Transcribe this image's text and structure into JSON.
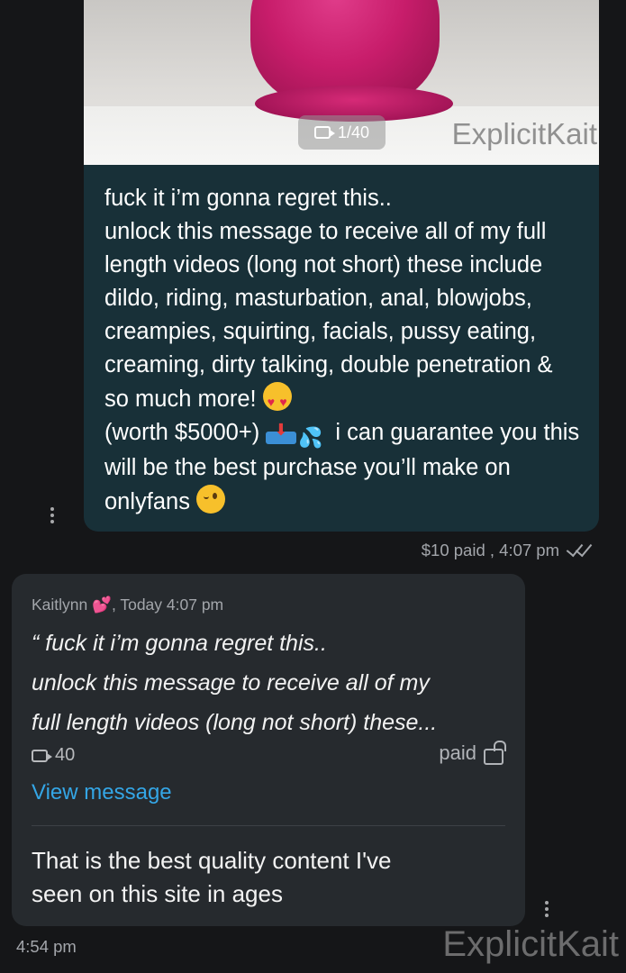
{
  "media": {
    "counter": "1/40",
    "watermark": "ExplicitKait"
  },
  "outgoing_message": {
    "lines": {
      "l1": "fuck it i’m gonna regret this..",
      "l2": "unlock this message to receive all of my full length videos (long not short) these include dildo, riding, masturbation, anal, blowjobs, creampies, squirting, facials, pussy eating, creaming, dirty talking, double penetration & so much more!",
      "l3": "(worth $5000+)",
      "l4": "i can guarantee you this will be the best purchase you’ll make on onlyfans"
    },
    "meta": "$10 paid , 4:07 pm"
  },
  "incoming_message": {
    "quote_author": "Kaitlynn",
    "quote_time": ", Today 4:07 pm",
    "quote_text": "“ fuck it i’m gonna regret this..\nunlock this message to receive all of my\nfull length videos (long not short) these...",
    "media_count": "40",
    "paid_label": "paid",
    "view_link": "View message",
    "reply_text": "That is the best quality content I've\nseen on this site in ages",
    "time": "4:54 pm"
  },
  "footer_watermark": "ExplicitKait",
  "icons": {
    "video": "video-camera-icon",
    "lock": "unlocked-padlock-icon",
    "ticks": "double-check-icon",
    "more": "more-vertical-icon"
  },
  "colors": {
    "background": "#151618",
    "outgoing_bubble": "#183038",
    "incoming_bubble": "#262a2e",
    "link": "#34a6e6"
  }
}
